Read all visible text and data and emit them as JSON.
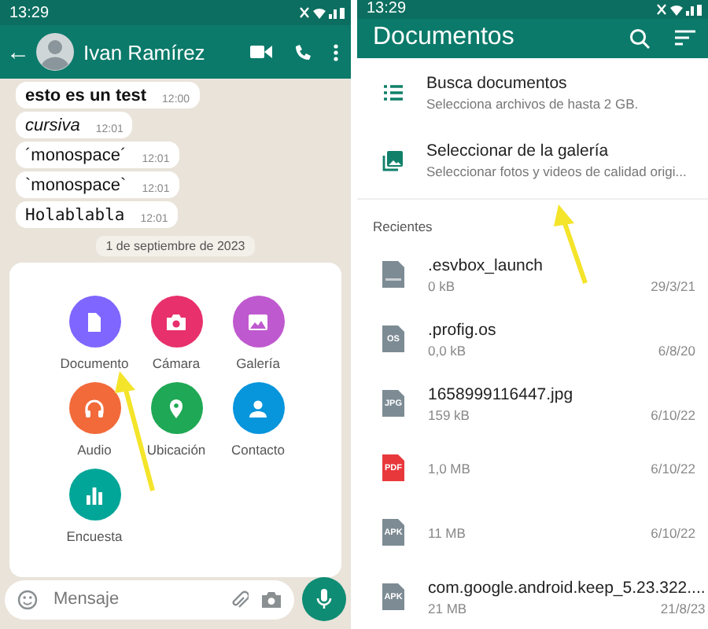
{
  "left": {
    "status_bar": {
      "time": "13:29"
    },
    "header": {
      "back": "←",
      "contact": "Ivan Ramírez"
    },
    "messages": [
      {
        "kind": "bold",
        "text": "esto es un test",
        "time": "12:00"
      },
      {
        "kind": "italic",
        "text": "cursiva",
        "time": "12:01"
      },
      {
        "kind": "plain",
        "text": "´monospace´",
        "time": "12:01"
      },
      {
        "kind": "plain",
        "text": "`monospace`",
        "time": "12:01"
      },
      {
        "kind": "mono",
        "text": "Holablabla",
        "time": "12:01"
      }
    ],
    "date_chip": "1 de septiembre de 2023",
    "attach_menu": [
      {
        "kind": "document",
        "label": "Documento",
        "color": "#7f66ff"
      },
      {
        "kind": "camera",
        "label": "Cámara",
        "color": "#e8306c"
      },
      {
        "kind": "gallery",
        "label": "Galería",
        "color": "#bf59cf"
      },
      {
        "kind": "audio",
        "label": "Audio",
        "color": "#f26a3a"
      },
      {
        "kind": "location",
        "label": "Ubicación",
        "color": "#1fa855"
      },
      {
        "kind": "contact",
        "label": "Contacto",
        "color": "#0795dc"
      },
      {
        "kind": "poll",
        "label": "Encuesta",
        "color": "#02a698"
      }
    ],
    "composer": {
      "placeholder": "Mensaje"
    }
  },
  "right": {
    "status_bar": {
      "time": "13:29"
    },
    "header": {
      "title": "Documentos"
    },
    "actions": [
      {
        "kind": "list",
        "title": "Busca documentos",
        "subtitle": "Selecciona archivos de hasta 2 GB."
      },
      {
        "kind": "gallery",
        "title": "Seleccionar de la galería",
        "subtitle": "Seleccionar fotos y videos de calidad origi..."
      }
    ],
    "section": "Recientes",
    "files": [
      {
        "name": ".esvbox_launch",
        "size": "0 kB",
        "date": "29/3/21",
        "color": "#7d8b94"
      },
      {
        "name": ".profig.os",
        "tag": "OS",
        "size": "0,0 kB",
        "date": "6/8/20",
        "color": "#7d8b94"
      },
      {
        "name": "1658999116447.jpg",
        "tag": "JPG",
        "size": "159 kB",
        "date": "6/10/22",
        "color": "#7d8b94"
      },
      {
        "tag": "PDF",
        "size": "1,0 MB",
        "date": "6/10/22",
        "color": "#e8383c"
      },
      {
        "tag": "APK",
        "size": "11 MB",
        "date": "6/10/22",
        "color": "#7d8b94"
      },
      {
        "name": "com.google.android.keep_5.23.322....",
        "tag": "APK",
        "size": "21 MB",
        "date": "21/8/23",
        "color": "#7d8b94"
      }
    ]
  }
}
